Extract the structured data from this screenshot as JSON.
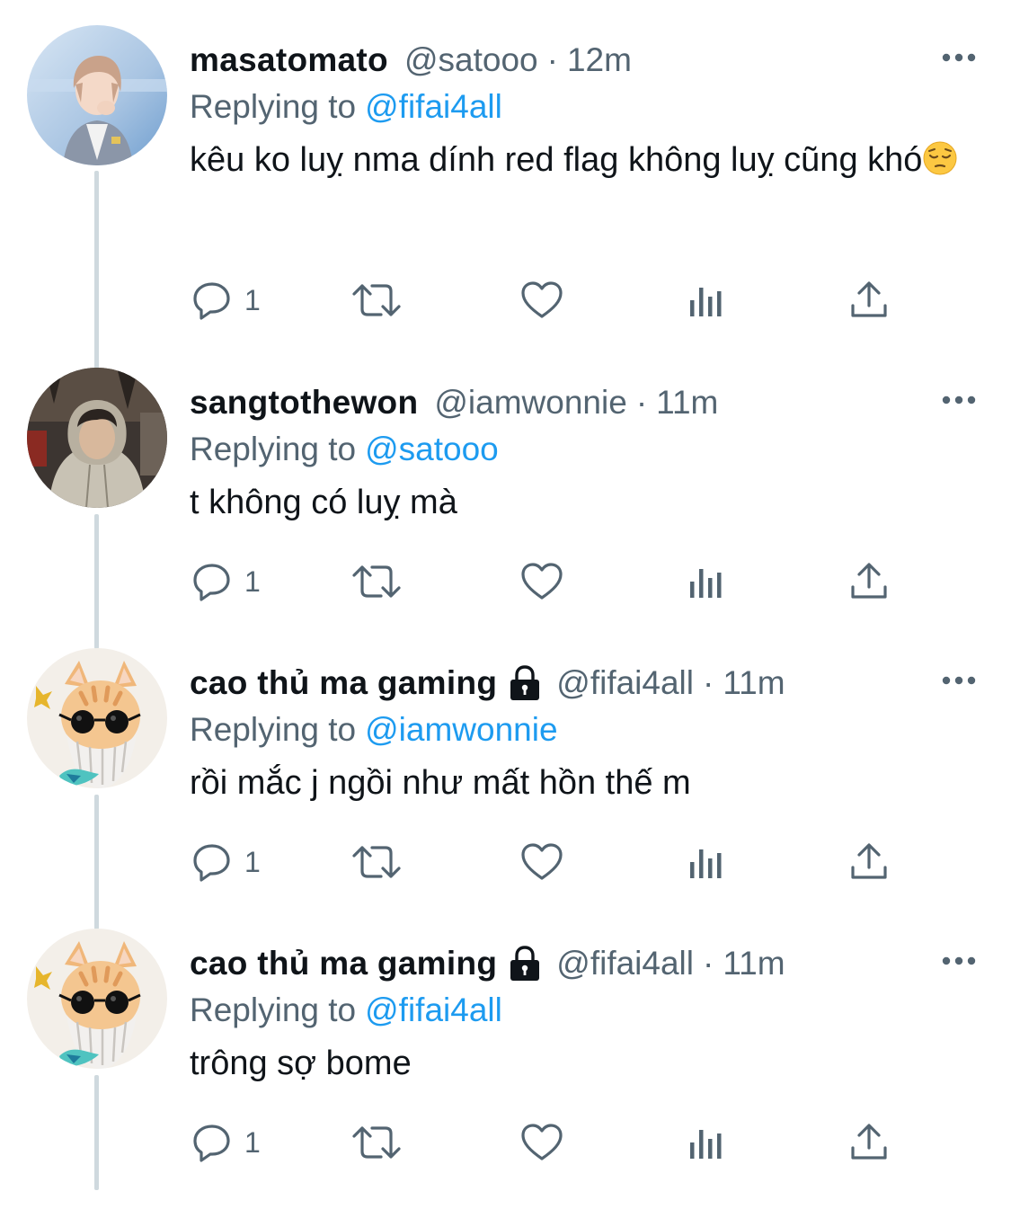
{
  "tweets": [
    {
      "display_name": "masatomato",
      "locked": false,
      "handle": "@satooo",
      "separator": "·",
      "time": "12m",
      "replying_prefix": "Replying to",
      "replying_to": "@fifai4all",
      "text": "kêu ko luỵ nma dính red flag không luỵ cũng khó",
      "text_emoji": "pensive-face-emoji",
      "reply_count": "1",
      "avatar": "avatar-photo-boy-blazer"
    },
    {
      "display_name": "sangtothewon",
      "locked": false,
      "handle": "@iamwonnie",
      "separator": "·",
      "time": "11m",
      "replying_prefix": "Replying to",
      "replying_to": "@satooo",
      "text": "t không có luỵ mà",
      "reply_count": "1",
      "avatar": "avatar-photo-hoodie-night"
    },
    {
      "display_name": "cao thủ ma gaming",
      "locked": true,
      "handle": "@fifai4all",
      "separator": "·",
      "time": "11m",
      "replying_prefix": "Replying to",
      "replying_to": "@iamwonnie",
      "text": "rồi mắc j ngồi như mất hồn thế m",
      "reply_count": "1",
      "avatar": "avatar-cat-sunglasses"
    },
    {
      "display_name": "cao thủ ma gaming",
      "locked": true,
      "handle": "@fifai4all",
      "separator": "·",
      "time": "11m",
      "replying_prefix": "Replying to",
      "replying_to": "@fifai4all",
      "text": "trông sợ bome",
      "reply_count": "1",
      "avatar": "avatar-cat-sunglasses"
    }
  ],
  "icons": {
    "reply": "reply-icon",
    "retweet": "retweet-icon",
    "like": "heart-icon",
    "views": "analytics-icon",
    "share": "share-icon",
    "more": "more-icon",
    "lock": "lock-icon"
  },
  "colors": {
    "link": "#1d9bf0",
    "secondary_text": "#536471",
    "primary_text": "#0f1419",
    "thread_line": "#cfd9de"
  }
}
